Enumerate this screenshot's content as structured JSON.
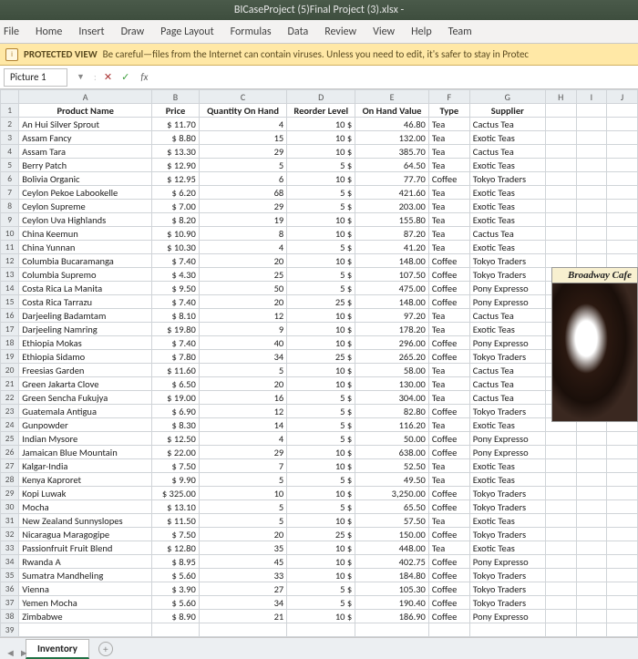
{
  "title": "BICaseProject (5)Final Project (3).xlsx - ",
  "menu": [
    "File",
    "Home",
    "Insert",
    "Draw",
    "Page Layout",
    "Formulas",
    "Data",
    "Review",
    "View",
    "Help",
    "Team"
  ],
  "protected": {
    "label": "PROTECTED VIEW",
    "text": "Be careful—files from the Internet can contain viruses. Unless you need to edit, it's safer to stay in Protec"
  },
  "namebox": "Picture 1",
  "fx_label": "fx",
  "columns": [
    "A",
    "B",
    "C",
    "D",
    "E",
    "F",
    "G",
    "H",
    "I",
    "J"
  ],
  "headers": {
    "row": "1",
    "A": "Product Name",
    "B": "Price",
    "C": "Quantity On Hand",
    "D": "Reorder Level",
    "E": "On Hand Value",
    "F": "Type",
    "G": "Supplier"
  },
  "rows": [
    {
      "n": "2",
      "name": "An Hui Silver Sprout",
      "price": "11.70",
      "qoh": "4",
      "re": "10",
      "cur": "$",
      "val": "46.80",
      "type": "Tea",
      "sup": "Cactus Tea"
    },
    {
      "n": "3",
      "name": "Assam Fancy",
      "price": "8.80",
      "qoh": "15",
      "re": "10",
      "cur": "$",
      "val": "132.00",
      "type": "Tea",
      "sup": "Exotic Teas"
    },
    {
      "n": "4",
      "name": "Assam Tara",
      "price": "13.30",
      "qoh": "29",
      "re": "10",
      "cur": "$",
      "val": "385.70",
      "type": "Tea",
      "sup": "Cactus Tea"
    },
    {
      "n": "5",
      "name": "Berry Patch",
      "price": "12.90",
      "qoh": "5",
      "re": "5",
      "cur": "$",
      "val": "64.50",
      "type": "Tea",
      "sup": "Exotic Teas"
    },
    {
      "n": "6",
      "name": "Bolivia Organic",
      "price": "12.95",
      "qoh": "6",
      "re": "10",
      "cur": "$",
      "val": "77.70",
      "type": "Coffee",
      "sup": "Tokyo Traders"
    },
    {
      "n": "7",
      "name": "Ceylon Pekoe Labookelle",
      "price": "6.20",
      "qoh": "68",
      "re": "5",
      "cur": "$",
      "val": "421.60",
      "type": "Tea",
      "sup": "Exotic Teas"
    },
    {
      "n": "8",
      "name": "Ceylon Supreme",
      "price": "7.00",
      "qoh": "29",
      "re": "5",
      "cur": "$",
      "val": "203.00",
      "type": "Tea",
      "sup": "Exotic Teas"
    },
    {
      "n": "9",
      "name": "Ceylon Uva Highlands",
      "price": "8.20",
      "qoh": "19",
      "re": "10",
      "cur": "$",
      "val": "155.80",
      "type": "Tea",
      "sup": "Exotic Teas"
    },
    {
      "n": "10",
      "name": "China Keemun",
      "price": "10.90",
      "qoh": "8",
      "re": "10",
      "cur": "$",
      "val": "87.20",
      "type": "Tea",
      "sup": "Cactus Tea"
    },
    {
      "n": "11",
      "name": "China Yunnan",
      "price": "10.30",
      "qoh": "4",
      "re": "5",
      "cur": "$",
      "val": "41.20",
      "type": "Tea",
      "sup": "Exotic Teas"
    },
    {
      "n": "12",
      "name": "Columbia Bucaramanga",
      "price": "7.40",
      "qoh": "20",
      "re": "10",
      "cur": "$",
      "val": "148.00",
      "type": "Coffee",
      "sup": "Tokyo Traders"
    },
    {
      "n": "13",
      "name": "Columbia Supremo",
      "price": "4.30",
      "qoh": "25",
      "re": "5",
      "cur": "$",
      "val": "107.50",
      "type": "Coffee",
      "sup": "Tokyo Traders"
    },
    {
      "n": "14",
      "name": "Costa Rica La Manita",
      "price": "9.50",
      "qoh": "50",
      "re": "5",
      "cur": "$",
      "val": "475.00",
      "type": "Coffee",
      "sup": "Pony Expresso"
    },
    {
      "n": "15",
      "name": "Costa Rica Tarrazu",
      "price": "7.40",
      "qoh": "20",
      "re": "25",
      "cur": "$",
      "val": "148.00",
      "type": "Coffee",
      "sup": "Pony Expresso"
    },
    {
      "n": "16",
      "name": "Darjeeling Badamtam",
      "price": "8.10",
      "qoh": "12",
      "re": "10",
      "cur": "$",
      "val": "97.20",
      "type": "Tea",
      "sup": "Cactus Tea"
    },
    {
      "n": "17",
      "name": "Darjeeling Namring",
      "price": "19.80",
      "qoh": "9",
      "re": "10",
      "cur": "$",
      "val": "178.20",
      "type": "Tea",
      "sup": "Exotic Teas"
    },
    {
      "n": "18",
      "name": "Ethiopia Mokas",
      "price": "7.40",
      "qoh": "40",
      "re": "10",
      "cur": "$",
      "val": "296.00",
      "type": "Coffee",
      "sup": "Pony Expresso"
    },
    {
      "n": "19",
      "name": "Ethiopia Sidamo",
      "price": "7.80",
      "qoh": "34",
      "re": "25",
      "cur": "$",
      "val": "265.20",
      "type": "Coffee",
      "sup": "Tokyo Traders"
    },
    {
      "n": "20",
      "name": "Freesias Garden",
      "price": "11.60",
      "qoh": "5",
      "re": "10",
      "cur": "$",
      "val": "58.00",
      "type": "Tea",
      "sup": "Cactus Tea"
    },
    {
      "n": "21",
      "name": "Green Jakarta Clove",
      "price": "6.50",
      "qoh": "20",
      "re": "10",
      "cur": "$",
      "val": "130.00",
      "type": "Tea",
      "sup": "Cactus Tea"
    },
    {
      "n": "22",
      "name": "Green Sencha Fukujya",
      "price": "19.00",
      "qoh": "16",
      "re": "5",
      "cur": "$",
      "val": "304.00",
      "type": "Tea",
      "sup": "Cactus Tea"
    },
    {
      "n": "23",
      "name": "Guatemala Antigua",
      "price": "6.90",
      "qoh": "12",
      "re": "5",
      "cur": "$",
      "val": "82.80",
      "type": "Coffee",
      "sup": "Tokyo Traders"
    },
    {
      "n": "24",
      "name": "Gunpowder",
      "price": "8.30",
      "qoh": "14",
      "re": "5",
      "cur": "$",
      "val": "116.20",
      "type": "Tea",
      "sup": "Exotic Teas"
    },
    {
      "n": "25",
      "name": "Indian Mysore",
      "price": "12.50",
      "qoh": "4",
      "re": "5",
      "cur": "$",
      "val": "50.00",
      "type": "Coffee",
      "sup": "Pony Expresso"
    },
    {
      "n": "26",
      "name": "Jamaican Blue Mountain",
      "price": "22.00",
      "qoh": "29",
      "re": "10",
      "cur": "$",
      "val": "638.00",
      "type": "Coffee",
      "sup": "Pony Expresso"
    },
    {
      "n": "27",
      "name": "Kalgar-India",
      "price": "7.50",
      "qoh": "7",
      "re": "10",
      "cur": "$",
      "val": "52.50",
      "type": "Tea",
      "sup": "Exotic Teas"
    },
    {
      "n": "28",
      "name": "Kenya Kaproret",
      "price": "9.90",
      "qoh": "5",
      "re": "5",
      "cur": "$",
      "val": "49.50",
      "type": "Tea",
      "sup": "Exotic Teas"
    },
    {
      "n": "29",
      "name": "Kopi Luwak",
      "price": "325.00",
      "qoh": "10",
      "re": "10",
      "cur": "$",
      "val": "3,250.00",
      "type": "Coffee",
      "sup": "Tokyo Traders"
    },
    {
      "n": "30",
      "name": "Mocha",
      "price": "13.10",
      "qoh": "5",
      "re": "5",
      "cur": "$",
      "val": "65.50",
      "type": "Coffee",
      "sup": "Tokyo Traders"
    },
    {
      "n": "31",
      "name": "New Zealand Sunnyslopes",
      "price": "11.50",
      "qoh": "5",
      "re": "10",
      "cur": "$",
      "val": "57.50",
      "type": "Tea",
      "sup": "Exotic Teas"
    },
    {
      "n": "32",
      "name": "Nicaragua Maragogipe",
      "price": "7.50",
      "qoh": "20",
      "re": "25",
      "cur": "$",
      "val": "150.00",
      "type": "Coffee",
      "sup": "Tokyo Traders"
    },
    {
      "n": "33",
      "name": "Passionfruit Fruit Blend",
      "price": "12.80",
      "qoh": "35",
      "re": "10",
      "cur": "$",
      "val": "448.00",
      "type": "Tea",
      "sup": "Exotic Teas"
    },
    {
      "n": "34",
      "name": "Rwanda A",
      "price": "8.95",
      "qoh": "45",
      "re": "10",
      "cur": "$",
      "val": "402.75",
      "type": "Coffee",
      "sup": "Pony Expresso"
    },
    {
      "n": "35",
      "name": "Sumatra Mandheling",
      "price": "5.60",
      "qoh": "33",
      "re": "10",
      "cur": "$",
      "val": "184.80",
      "type": "Coffee",
      "sup": "Tokyo Traders"
    },
    {
      "n": "36",
      "name": "Vienna",
      "price": "3.90",
      "qoh": "27",
      "re": "5",
      "cur": "$",
      "val": "105.30",
      "type": "Coffee",
      "sup": "Tokyo Traders"
    },
    {
      "n": "37",
      "name": "Yemen Mocha",
      "price": "5.60",
      "qoh": "34",
      "re": "5",
      "cur": "$",
      "val": "190.40",
      "type": "Coffee",
      "sup": "Tokyo Traders"
    },
    {
      "n": "38",
      "name": "Zimbabwe",
      "price": "8.90",
      "qoh": "21",
      "re": "10",
      "cur": "$",
      "val": "186.90",
      "type": "Coffee",
      "sup": "Pony Expresso"
    },
    {
      "n": "39",
      "name": "",
      "price": "",
      "qoh": "",
      "re": "",
      "cur": "",
      "val": "",
      "type": "",
      "sup": ""
    }
  ],
  "img_label": "Broadway Cafe",
  "sheet_tab": "Inventory",
  "currency": "$"
}
